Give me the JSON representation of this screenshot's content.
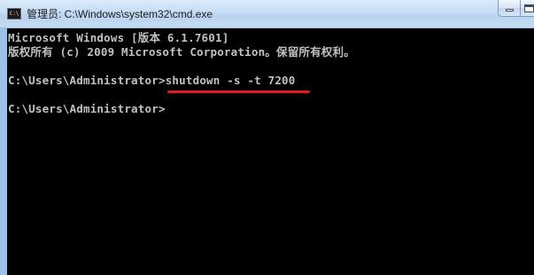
{
  "window": {
    "title": "管理员: C:\\Windows\\system32\\cmd.exe",
    "icon": "console-app-icon",
    "icon_text": "C:\\"
  },
  "console": {
    "lines": [
      "Microsoft Windows [版本 6.1.7601]",
      "版权所有 (c) 2009 Microsoft Corporation。保留所有权利。",
      "",
      "C:\\Users\\Administrator>",
      "shutdown -s -t 7200",
      "",
      "C:\\Users\\Administrator>"
    ],
    "prompt_1": "C:\\Users\\Administrator>",
    "command_1": "shutdown -s -t 7200",
    "prompt_2": "C:\\Users\\Administrator>",
    "version_line": "Microsoft Windows [版本 6.1.7601]",
    "copyright_line": "版权所有 (c) 2009 Microsoft Corporation。保留所有权利。"
  },
  "colors": {
    "console_bg": "#000000",
    "console_text": "#c0c0c0",
    "highlight_underline": "#e31b1b",
    "titlebar": "#c6dcf3"
  }
}
